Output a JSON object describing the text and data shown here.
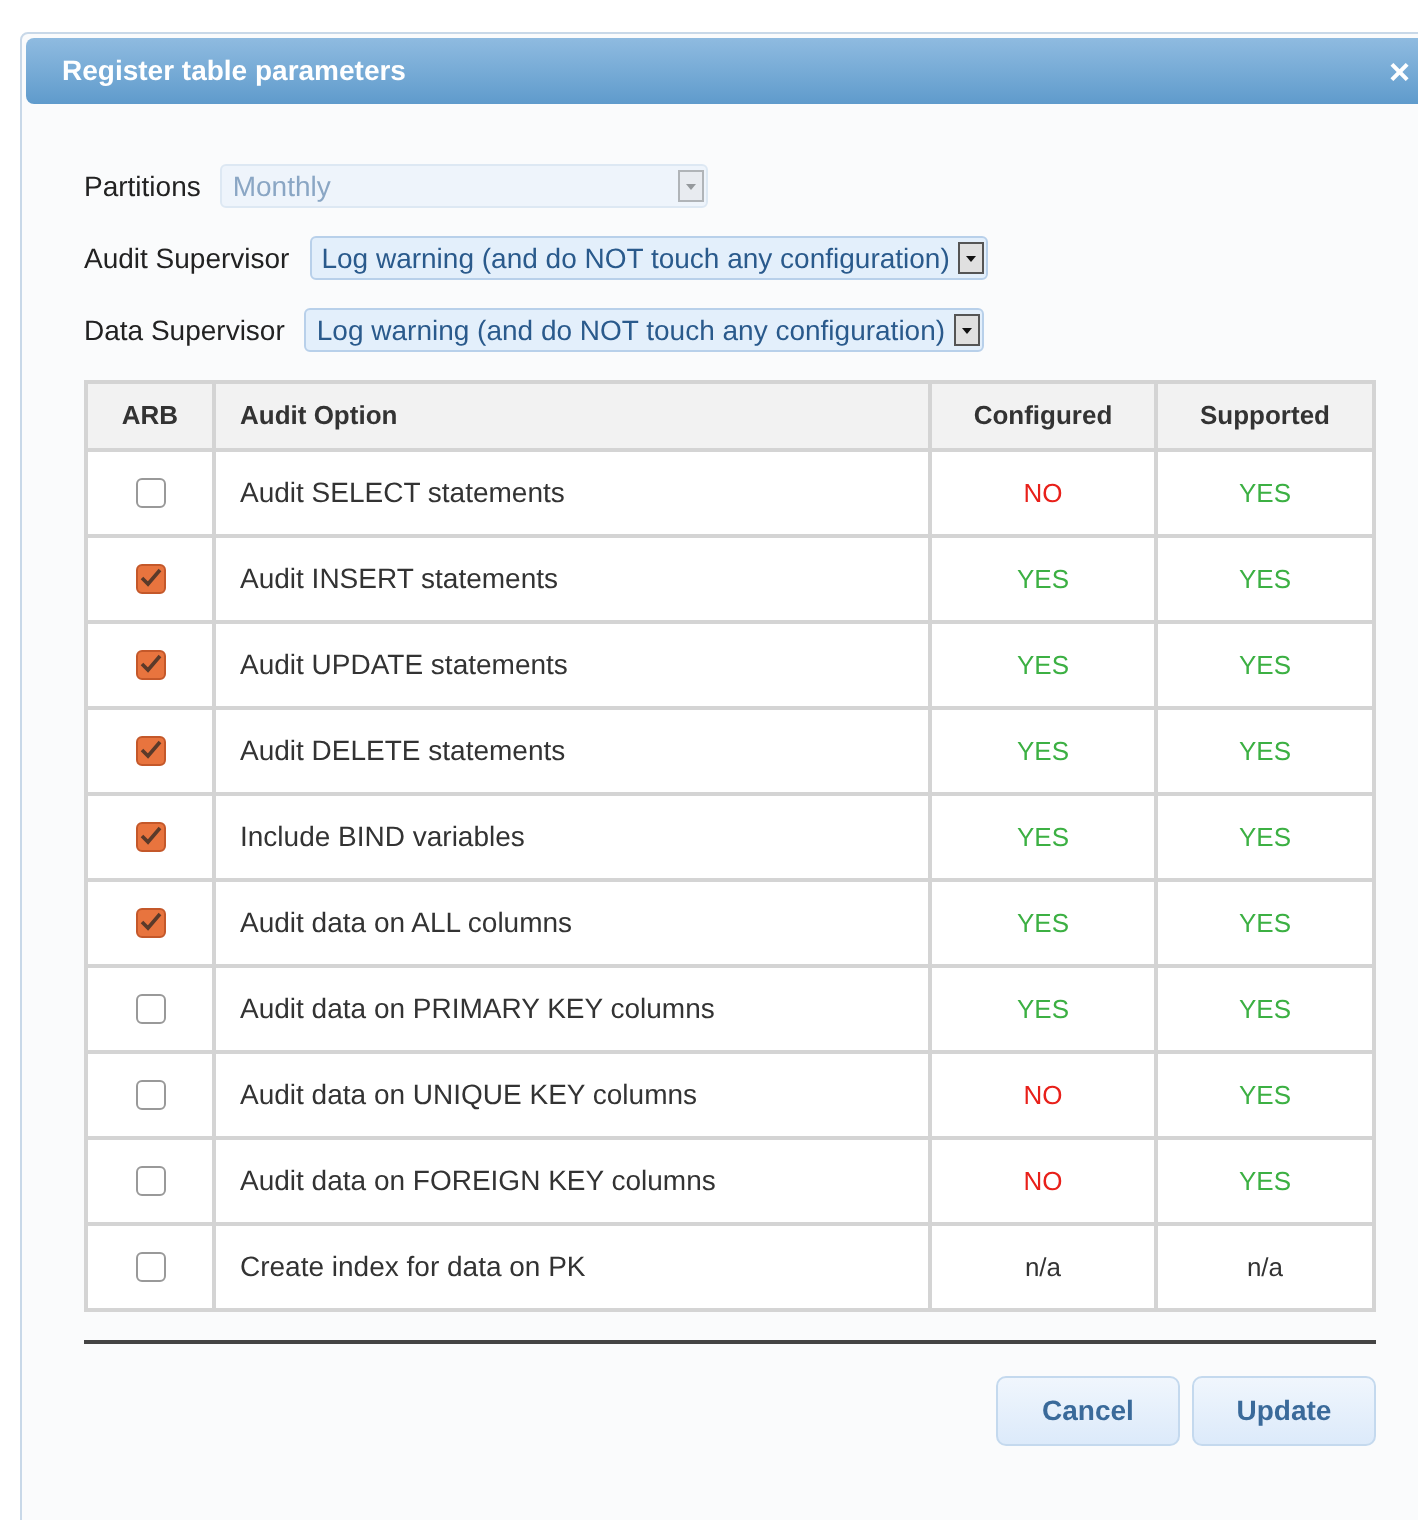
{
  "dialog": {
    "title": "Register table parameters",
    "close": "×"
  },
  "fields": [
    {
      "label": "Partitions",
      "value": "Monthly",
      "disabled": true
    },
    {
      "label": "Audit Supervisor",
      "value": "Log warning (and do NOT touch any configuration)",
      "disabled": false
    },
    {
      "label": "Data Supervisor",
      "value": "Log warning (and do NOT touch any configuration)",
      "disabled": false
    }
  ],
  "table": {
    "columns": [
      "ARB",
      "Audit Option",
      "Configured",
      "Supported"
    ],
    "rows": [
      {
        "checked": false,
        "option": "Audit SELECT statements",
        "configured": {
          "text": "NO",
          "color": "#e8201a"
        },
        "supported": {
          "text": "YES",
          "color": "#3cb043"
        }
      },
      {
        "checked": true,
        "option": "Audit INSERT statements",
        "configured": {
          "text": "YES",
          "color": "#3cb043"
        },
        "supported": {
          "text": "YES",
          "color": "#3cb043"
        }
      },
      {
        "checked": true,
        "option": "Audit UPDATE statements",
        "configured": {
          "text": "YES",
          "color": "#3cb043"
        },
        "supported": {
          "text": "YES",
          "color": "#3cb043"
        }
      },
      {
        "checked": true,
        "option": "Audit DELETE statements",
        "configured": {
          "text": "YES",
          "color": "#3cb043"
        },
        "supported": {
          "text": "YES",
          "color": "#3cb043"
        }
      },
      {
        "checked": true,
        "option": "Include BIND variables",
        "configured": {
          "text": "YES",
          "color": "#3cb043"
        },
        "supported": {
          "text": "YES",
          "color": "#3cb043"
        }
      },
      {
        "checked": true,
        "option": "Audit data on ALL columns",
        "configured": {
          "text": "YES",
          "color": "#3cb043"
        },
        "supported": {
          "text": "YES",
          "color": "#3cb043"
        }
      },
      {
        "checked": false,
        "option": "Audit data on PRIMARY KEY columns",
        "configured": {
          "text": "YES",
          "color": "#3cb043"
        },
        "supported": {
          "text": "YES",
          "color": "#3cb043"
        }
      },
      {
        "checked": false,
        "option": "Audit data on UNIQUE KEY columns",
        "configured": {
          "text": "NO",
          "color": "#e8201a"
        },
        "supported": {
          "text": "YES",
          "color": "#3cb043"
        }
      },
      {
        "checked": false,
        "option": "Audit data on FOREIGN KEY columns",
        "configured": {
          "text": "NO",
          "color": "#e8201a"
        },
        "supported": {
          "text": "YES",
          "color": "#3cb043"
        }
      },
      {
        "checked": false,
        "option": "Create index for data on PK",
        "configured": {
          "text": "n/a",
          "color": "#333333"
        },
        "supported": {
          "text": "n/a",
          "color": "#333333"
        }
      }
    ]
  },
  "buttons": [
    "Cancel",
    "Update"
  ]
}
